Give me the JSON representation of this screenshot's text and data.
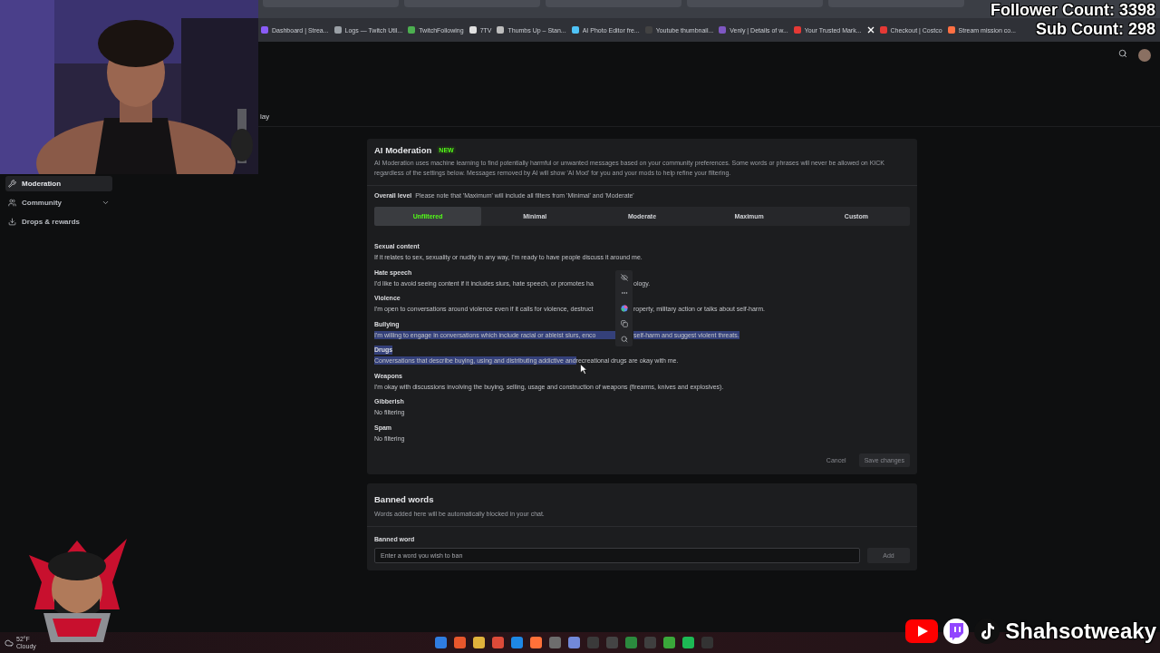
{
  "browser": {
    "bookmarks": [
      {
        "kind": "link",
        "label": "Dashboard | Strea..."
      },
      {
        "kind": "link",
        "label": "Logs — Twitch Util..."
      },
      {
        "kind": "link",
        "label": "TwitchFollowing"
      },
      {
        "kind": "link",
        "label": "7TV"
      },
      {
        "kind": "link",
        "label": "Thumbs Up – Stan..."
      },
      {
        "kind": "link",
        "label": "AI Photo Editor fre..."
      },
      {
        "kind": "link",
        "label": "Youtube thumbnail..."
      },
      {
        "kind": "link",
        "label": "Venly | Details of w..."
      },
      {
        "kind": "link",
        "label": "Your Trusted Mark..."
      },
      {
        "kind": "icon"
      },
      {
        "kind": "link",
        "label": "Checkout | Costco"
      },
      {
        "kind": "link",
        "label": "Stream mission co..."
      }
    ]
  },
  "overlay": {
    "follower_count": "Follower Count: 3398",
    "sub_count": "Sub Count: 298",
    "channel_name": "Shahsotweaky"
  },
  "header": {
    "title_fragment": "lay"
  },
  "sidebar": {
    "items": [
      {
        "label": "Moderation",
        "selected": true,
        "expandable": false
      },
      {
        "label": "Community",
        "selected": false,
        "expandable": true
      },
      {
        "label": "Drops & rewards",
        "selected": false,
        "expandable": false
      }
    ]
  },
  "ai_moderation": {
    "title": "AI Moderation",
    "badge": "NEW",
    "description": "AI Moderation uses machine learning to find potentially harmful or unwanted messages based on your community preferences. Some words or phrases will never be allowed on KICK regardless of the settings below. Messages removed by AI will show 'AI Mod' for you and your mods to help refine your filtering.",
    "overall_level": {
      "label": "Overall level",
      "note": "Please note that 'Maximum' will include all filters from 'Minimal' and 'Moderate'"
    },
    "levels": [
      {
        "label": "Unfiltered",
        "selected": true
      },
      {
        "label": "Minimal",
        "selected": false
      },
      {
        "label": "Moderate",
        "selected": false
      },
      {
        "label": "Maximum",
        "selected": false
      },
      {
        "label": "Custom",
        "selected": false
      }
    ],
    "categories": [
      {
        "title": "Sexual content",
        "title_selected": false,
        "description": [
          {
            "kind": "text",
            "text": "If it relates to sex, sexuality or nudity in any way, I'm ready to have people discuss it around me.",
            "selected": false
          }
        ]
      },
      {
        "title": "Hate speech",
        "title_selected": false,
        "description": [
          {
            "kind": "text",
            "text": "I'd like to avoid seeing content if it includes slurs, hate speech, or promotes ha",
            "selected": false
          },
          {
            "kind": "gap"
          },
          {
            "kind": "text",
            "text": "ology.",
            "selected": false
          }
        ]
      },
      {
        "title": "Violence",
        "title_selected": false,
        "description": [
          {
            "kind": "text",
            "text": "I'm open to conversations around violence even if it calls for violence, destruct",
            "selected": false
          },
          {
            "kind": "gap"
          },
          {
            "kind": "text",
            "text": "roperty, military action or talks about self-harm.",
            "selected": false
          }
        ]
      },
      {
        "title": "Bullying",
        "title_selected": false,
        "description": [
          {
            "kind": "text",
            "text": "I'm willing to engage in conversations which include racial or ableist slurs, enco",
            "selected": true
          },
          {
            "kind": "gap"
          },
          {
            "kind": "text",
            "text": "self-harm and suggest violent threats.",
            "selected": true
          }
        ]
      },
      {
        "title": "Drugs",
        "title_selected": true,
        "description": [
          {
            "kind": "text",
            "text": "Conversations that describe buying, using and distributing addictive and",
            "selected": true
          },
          {
            "kind": "text",
            "text": " recreational drugs are okay with me.",
            "selected": false
          }
        ]
      },
      {
        "title": "Weapons",
        "title_selected": false,
        "description": [
          {
            "kind": "text",
            "text": "I'm okay with discussions involving the buying, selling, usage and construction of weapons (firearms, knives and explosives).",
            "selected": false
          }
        ]
      },
      {
        "title": "Gibberish",
        "title_selected": false,
        "description": [
          {
            "kind": "text",
            "text": "No filtering",
            "selected": false
          }
        ]
      },
      {
        "title": "Spam",
        "title_selected": false,
        "description": [
          {
            "kind": "text",
            "text": "No filtering",
            "selected": false
          }
        ]
      }
    ],
    "actions": {
      "cancel": "Cancel",
      "save": "Save changes",
      "disabled": true
    }
  },
  "banned_words": {
    "title": "Banned words",
    "description": "Words added here will be automatically blocked in your chat.",
    "field_label": "Banned word",
    "placeholder": "Enter a word you wish to ban",
    "add": "Add",
    "add_disabled": true
  },
  "taskbar": {
    "temperature": "52°F",
    "condition": "Cloudy"
  }
}
